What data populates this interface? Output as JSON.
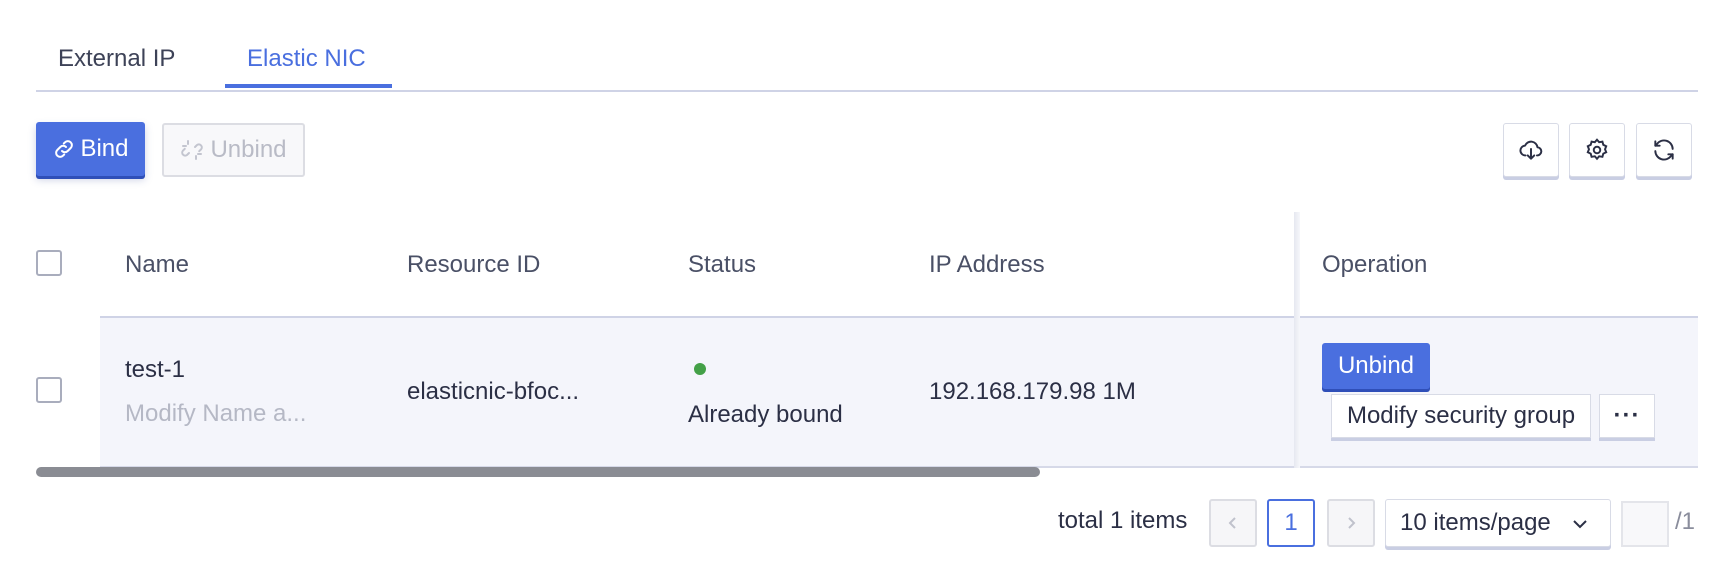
{
  "tabs": [
    {
      "label": "External IP",
      "active": false
    },
    {
      "label": "Elastic NIC",
      "active": true
    }
  ],
  "toolbar": {
    "bind_label": "Bind",
    "unbind_label": "Unbind",
    "icons": [
      "cloud-download-icon",
      "gear-icon",
      "refresh-icon"
    ]
  },
  "table": {
    "headers": {
      "name": "Name",
      "resource_id": "Resource ID",
      "status": "Status",
      "ip_address": "IP Address",
      "operation": "Operation"
    },
    "rows": [
      {
        "name": "test-1",
        "name_sub": "Modify Name a...",
        "resource_id": "elasticnic-bfoc...",
        "status": "Already bound",
        "ip_address": "192.168.179.98 1M",
        "op_unbind": "Unbind",
        "op_modify": "Modify security group",
        "op_more": "···"
      }
    ]
  },
  "pagination": {
    "total_text": "total 1 items",
    "current_page": "1",
    "page_size": "10 items/page",
    "total_pages": "/1"
  },
  "colors": {
    "accent": "#4a6fdf",
    "status_ok": "#43a047"
  }
}
